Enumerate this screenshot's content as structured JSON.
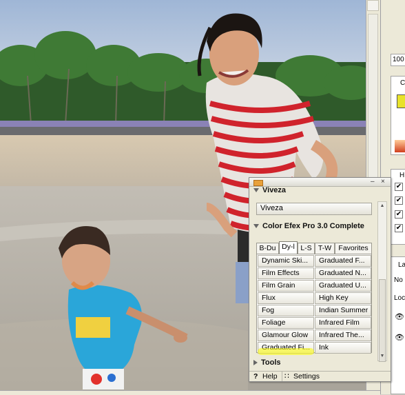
{
  "right_panels": {
    "zoom_value": "100",
    "label_C": "C",
    "label_H": "H",
    "label_La": "La",
    "label_No": "No",
    "label_Loc": "Loc"
  },
  "panel": {
    "minimize_glyph": "–",
    "close_glyph": "×",
    "viveza_header": "Viveza",
    "viveza_button": "Viveza",
    "colorefex_header": "Color Efex Pro 3.0 Complete",
    "tabs": [
      "B-Du",
      "Dy-l",
      "L-S",
      "T-W",
      "Favorites"
    ],
    "filters": [
      [
        "Dynamic Ski...",
        "Graduated F..."
      ],
      [
        "Film Effects",
        "Graduated N..."
      ],
      [
        "Film Grain",
        "Graduated U..."
      ],
      [
        "Flux",
        "High Key"
      ],
      [
        "Fog",
        "Indian Summer"
      ],
      [
        "Foliage",
        "Infrared Film"
      ],
      [
        "Glamour Glow",
        "Infrared The..."
      ],
      [
        "Graduated Fi...",
        "Ink"
      ]
    ],
    "tools_header": "Tools",
    "help_label": "Help",
    "settings_label": "Settings",
    "help_icon": "?",
    "settings_icon": "∷"
  },
  "colors": {
    "highlight": "#ffff00",
    "swatch_yellow": "#e8e22a"
  }
}
